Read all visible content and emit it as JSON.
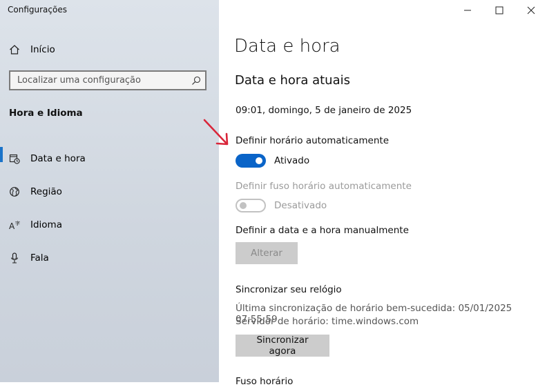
{
  "window": {
    "app_title": "Configurações"
  },
  "sidebar": {
    "home_label": "Início",
    "search_placeholder": "Localizar uma configuração",
    "section_title": "Hora e Idioma",
    "items": [
      {
        "label": "Data e hora",
        "icon": "calendar-clock-icon",
        "active": true
      },
      {
        "label": "Região",
        "icon": "globe-icon",
        "active": false
      },
      {
        "label": "Idioma",
        "icon": "language-icon",
        "active": false
      },
      {
        "label": "Fala",
        "icon": "microphone-icon",
        "active": false
      }
    ]
  },
  "main": {
    "title": "Data e hora",
    "subtitle": "Data e hora atuais",
    "current_time": "09:01, domingo, 5 de janeiro de 2025",
    "auto_time": {
      "label": "Definir horário automaticamente",
      "state": "Ativado",
      "on": true
    },
    "auto_timezone": {
      "label": "Definir fuso horário automaticamente",
      "state": "Desativado",
      "on": false
    },
    "manual": {
      "label": "Definir a data e a hora manualmente",
      "button": "Alterar"
    },
    "sync": {
      "label": "Sincronizar seu relógio",
      "last_sync": "Última sincronização de horário bem-sucedida: 05/01/2025 07:55:59",
      "server": "Servidor de horário: time.windows.com",
      "button": "Sincronizar agora"
    },
    "next_section": "Fuso horário"
  },
  "colors": {
    "accent": "#0a64c8",
    "annotation_arrow": "#d9263a"
  }
}
